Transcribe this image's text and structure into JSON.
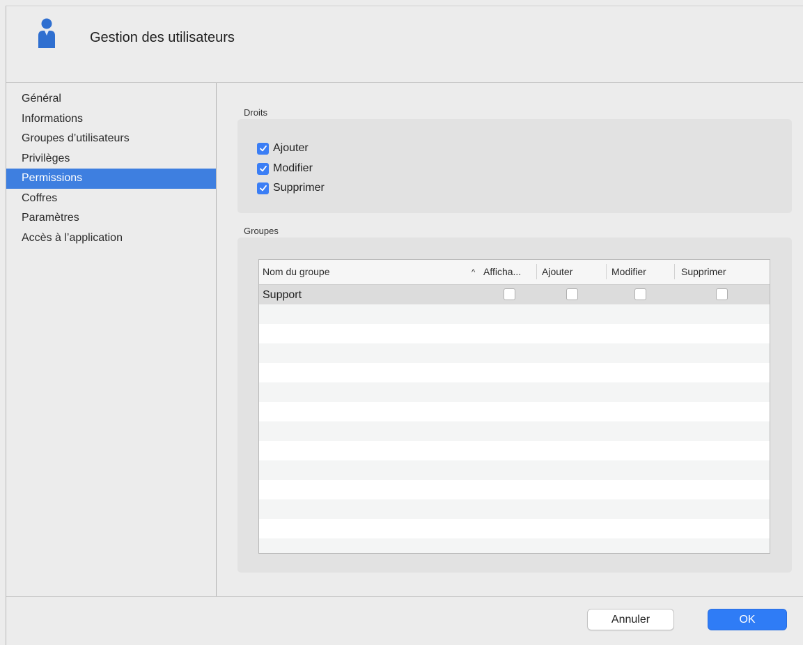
{
  "header": {
    "title": "Gestion des utilisateurs",
    "icon": "user-icon"
  },
  "sidebar": {
    "items": [
      {
        "label": "Général",
        "active": false
      },
      {
        "label": "Informations",
        "active": false
      },
      {
        "label": "Groupes d’utilisateurs",
        "active": false
      },
      {
        "label": "Privilèges",
        "active": false
      },
      {
        "label": "Permissions",
        "active": true
      },
      {
        "label": "Coffres",
        "active": false
      },
      {
        "label": "Paramètres",
        "active": false
      },
      {
        "label": "Accès à l’application",
        "active": false
      }
    ]
  },
  "droits": {
    "label": "Droits",
    "checkboxes": [
      {
        "label": "Ajouter",
        "checked": true
      },
      {
        "label": "Modifier",
        "checked": true
      },
      {
        "label": "Supprimer",
        "checked": true
      }
    ]
  },
  "groupes": {
    "label": "Groupes",
    "columns": {
      "name": "Nom du groupe",
      "sort_indicator": "^",
      "view": "Afficha...",
      "add": "Ajouter",
      "edit": "Modifier",
      "delete": "Supprimer"
    },
    "rows": [
      {
        "name": "Support",
        "view": false,
        "add": false,
        "edit": false,
        "delete": false
      }
    ]
  },
  "footer": {
    "cancel_label": "Annuler",
    "ok_label": "OK"
  },
  "colors": {
    "accent": "#3e7fe0",
    "ok_button": "#2f7cf6",
    "checkbox": "#3b7ef5"
  }
}
